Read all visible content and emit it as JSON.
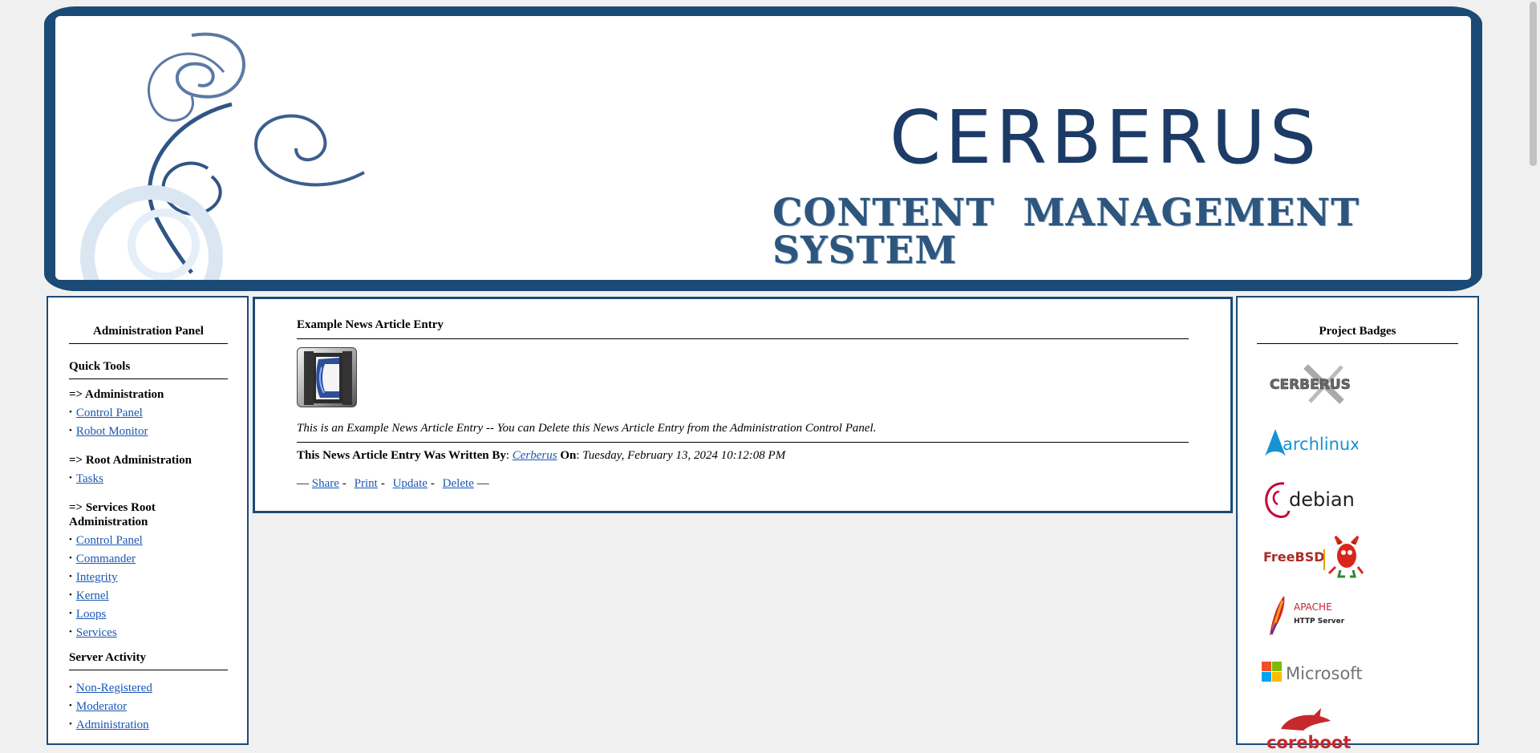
{
  "banner": {
    "title": "CERBERUS",
    "subtitle": "CONTENT MANAGEMENT SYSTEM"
  },
  "left_panel": {
    "title": "Administration Panel",
    "quick_tools_title": "Quick Tools",
    "groups": [
      {
        "title": "=> Administration",
        "links": [
          "Control Panel",
          "Robot Monitor"
        ]
      },
      {
        "title": "=> Root Administration",
        "links": [
          "Tasks"
        ]
      },
      {
        "title": "=> Services Root Administration",
        "links": [
          "Control Panel",
          "Commander",
          "Integrity",
          "Kernel",
          "Loops",
          "Services"
        ]
      }
    ],
    "server_activity_title": "Server Activity",
    "server_activity_links": [
      "Non-Registered",
      "Moderator",
      "Administration"
    ]
  },
  "article": {
    "title": "Example News Article Entry",
    "body": "This is an Example News Article Entry -- You can Delete this News Article Entry from the Administration Control Panel.",
    "written_by_label": "This News Article Entry Was Written By",
    "author": "Cerberus",
    "on_label": "On",
    "date": "Tuesday, February 13, 2024 10:12:08 PM",
    "actions": [
      "Share",
      "Print",
      "Update",
      "Delete"
    ],
    "dash": "—",
    "separator": "-"
  },
  "right_panel": {
    "title": "Project Badges",
    "badges": [
      {
        "name": "cerberus",
        "text": "CERBERUS",
        "icon": "cerberus-badge-icon"
      },
      {
        "name": "archlinux",
        "text": "archlinux",
        "icon": "arch-logo-icon",
        "color": "#1793d1"
      },
      {
        "name": "debian",
        "text": "debian",
        "icon": "debian-swirl-icon",
        "color": "#c70036"
      },
      {
        "name": "freebsd",
        "text": "FreeBSD",
        "icon": "freebsd-daemon-icon",
        "color": "#ab2b28"
      },
      {
        "name": "apache",
        "text": "APACHE",
        "subtext": "HTTP Server",
        "icon": "apache-feather-icon",
        "color": "#c92037"
      },
      {
        "name": "microsoft",
        "text": "Microsoft",
        "icon": "microsoft-logo-icon",
        "color": "#737373"
      },
      {
        "name": "coreboot",
        "text": "coreboot",
        "icon": "coreboot-hare-icon",
        "color": "#c7282b"
      }
    ]
  },
  "colors": {
    "frame": "#1b4a77",
    "link": "#1a57b3",
    "background": "#f0f0f0"
  }
}
